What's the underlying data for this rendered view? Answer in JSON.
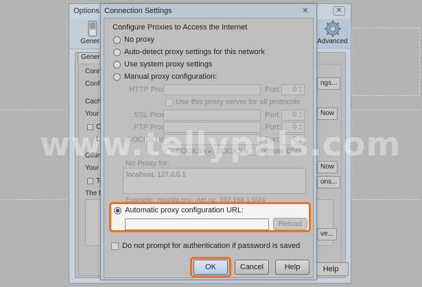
{
  "options_window": {
    "title": "Options",
    "close_glyph": "✕",
    "toolbar": {
      "general_label": "General",
      "advanced_label": "Advanced"
    },
    "tab_general": "General",
    "fragments": {
      "conn": "Conne",
      "confi": "Confi",
      "cache": "Cache",
      "your1": "Your w",
      "o": "O",
      "l": "L",
      "offline": "Offlin",
      "your2": "Your w",
      "te": "Te",
      "the_fo": "The fo",
      "ngs": "ngs...",
      "now1": "Now",
      "now2": "Now",
      "ons": "ons...",
      "ve": "ve..."
    },
    "help_label": "Help"
  },
  "dialog": {
    "title": "Connection Settings",
    "close_glyph": "✕",
    "heading": "Configure Proxies to Access the Internet",
    "radio_no_proxy": "No proxy",
    "radio_autodetect": "Auto-detect proxy settings for this network",
    "radio_system": "Use system proxy settings",
    "radio_manual": "Manual proxy configuration:",
    "http_proxy_label": "HTTP Proxy:",
    "port_label": "Port:",
    "port_value": "0",
    "same_proxy_label": "Use this proxy server for all protocols",
    "ssl_proxy_label": "SSL Proxy:",
    "ftp_proxy_label": "FTP Proxy:",
    "socks_host_label": "SOCKS Host:",
    "socks_v4": "SOCKS v4",
    "socks_v5": "SOCKS v5",
    "remote_dns": "Remote DNS",
    "no_proxy_for_label": "No Proxy for:",
    "no_proxy_for_value": "localhost, 127.0.0.1",
    "example_text": "Example: .mozilla.org, .net.nz, 192.168.1.0/24",
    "radio_auto_config": "Automatic proxy configuration URL:",
    "auto_config_url": "",
    "reload_label": "Reload",
    "no_prompt_label": "Do not prompt for authentication if password is saved",
    "ok_label": "OK",
    "cancel_label": "Cancel",
    "help_label": "Help"
  },
  "watermark": "www.tellypals.com",
  "colors": {
    "highlight": "#ef6f1a",
    "screen_overlay": "#b4b4b4",
    "dialog_chrome": "#bcc8d3"
  }
}
